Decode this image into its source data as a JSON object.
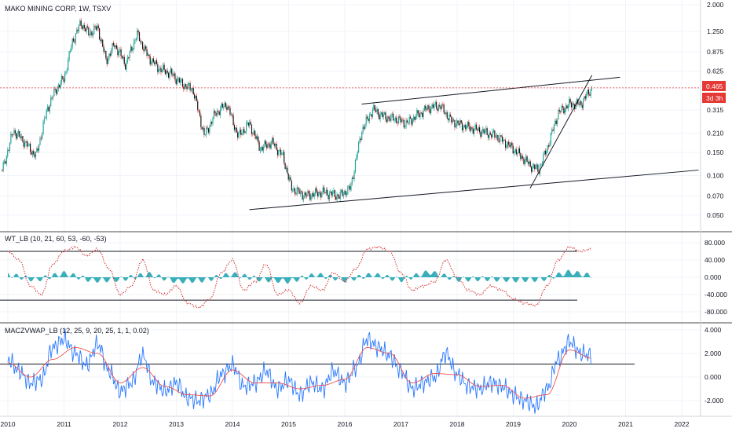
{
  "header": {
    "main_title": "MAKO MINING CORP, 1W, TSXV",
    "wt_title": "WT_LB (10, 21, 60, 53, -60, -53)",
    "macd_title": "MACZVWAP_LB (12, 25, 9, 20, 25, 1, 1, 0.02)"
  },
  "price_badge": {
    "value": "0.465",
    "countdown": "3d 3h"
  },
  "colors": {
    "up": "#26a69a",
    "down": "#ef5350",
    "candle_body": "#1a1a1a",
    "price_line": "#e53935",
    "wave": "#22a6b3",
    "wt_red": "#d32f2f",
    "macd_blue": "#2979ff",
    "macd_red": "#ef5350"
  },
  "chart_data": [
    {
      "type": "candlestick",
      "title": "MAKO MINING CORP, 1W, TSXV",
      "scale": "log",
      "x_ticks": [
        "2010",
        "2011",
        "2012",
        "2013",
        "2014",
        "2015",
        "2016",
        "2017",
        "2018",
        "2019",
        "2020",
        "2021",
        "2022"
      ],
      "y_ticks": [
        "2.000",
        "1.250",
        "0.875",
        "0.625",
        "0.465",
        "0.315",
        "0.210",
        "0.150",
        "0.100",
        "0.070",
        "0.050"
      ],
      "ylim": [
        0.04,
        2.0
      ],
      "last_price": 0.465,
      "series": [
        {
          "name": "close-approx",
          "x": [
            2009.9,
            2010.1,
            2010.3,
            2010.5,
            2010.7,
            2010.85,
            2011.0,
            2011.15,
            2011.3,
            2011.45,
            2011.6,
            2011.75,
            2011.9,
            2012.1,
            2012.3,
            2012.5,
            2012.7,
            2012.9,
            2013.1,
            2013.3,
            2013.5,
            2013.7,
            2013.9,
            2014.1,
            2014.3,
            2014.5,
            2014.7,
            2014.9,
            2015.05,
            2015.3,
            2015.6,
            2015.9,
            2016.1,
            2016.3,
            2016.5,
            2016.7,
            2016.9,
            2017.1,
            2017.3,
            2017.5,
            2017.7,
            2017.9,
            2018.1,
            2018.4,
            2018.7,
            2019.0,
            2019.3,
            2019.45,
            2019.6,
            2019.8,
            2020.0,
            2020.2,
            2020.4
          ],
          "values": [
            0.11,
            0.22,
            0.18,
            0.14,
            0.32,
            0.45,
            0.55,
            1.05,
            1.45,
            1.2,
            1.35,
            0.75,
            1.0,
            0.7,
            1.2,
            0.8,
            0.65,
            0.6,
            0.5,
            0.45,
            0.2,
            0.3,
            0.35,
            0.2,
            0.25,
            0.16,
            0.18,
            0.14,
            0.08,
            0.07,
            0.075,
            0.07,
            0.08,
            0.22,
            0.32,
            0.28,
            0.27,
            0.25,
            0.29,
            0.33,
            0.34,
            0.26,
            0.24,
            0.22,
            0.2,
            0.16,
            0.12,
            0.11,
            0.16,
            0.3,
            0.35,
            0.35,
            0.465
          ]
        }
      ],
      "trendlines": [
        {
          "name": "upper-channel",
          "points": [
            [
              2016.3,
              0.35
            ],
            [
              2020.9,
              0.56
            ]
          ]
        },
        {
          "name": "lower-channel",
          "points": [
            [
              2014.3,
              0.055
            ],
            [
              2022.3,
              0.11
            ]
          ]
        },
        {
          "name": "steep-support",
          "points": [
            [
              2019.3,
              0.08
            ],
            [
              2020.4,
              0.58
            ]
          ]
        }
      ]
    },
    {
      "type": "line",
      "title": "WT_LB (10, 21, 60, 53, -60, -53)",
      "y_ticks": [
        "80.000",
        "40.000",
        "0.000",
        "-40.000",
        "-80.000"
      ],
      "ylim": [
        -100,
        100
      ],
      "levels": [
        60,
        -53
      ],
      "series": [
        {
          "name": "wt1",
          "x": [
            2010.0,
            2010.2,
            2010.4,
            2010.6,
            2010.8,
            2011.0,
            2011.2,
            2011.4,
            2011.6,
            2011.8,
            2012.0,
            2012.2,
            2012.4,
            2012.6,
            2012.8,
            2013.0,
            2013.2,
            2013.4,
            2013.6,
            2013.8,
            2014.0,
            2014.2,
            2014.4,
            2014.6,
            2014.8,
            2015.0,
            2015.2,
            2015.4,
            2015.6,
            2015.8,
            2016.0,
            2016.2,
            2016.4,
            2016.6,
            2016.8,
            2017.0,
            2017.2,
            2017.4,
            2017.6,
            2017.8,
            2018.0,
            2018.2,
            2018.4,
            2018.6,
            2018.8,
            2019.0,
            2019.2,
            2019.4,
            2019.6,
            2019.8,
            2020.0,
            2020.2,
            2020.4
          ],
          "values": [
            60,
            40,
            -20,
            -40,
            30,
            60,
            70,
            50,
            65,
            20,
            -40,
            -20,
            40,
            -30,
            -40,
            -20,
            -60,
            -70,
            -50,
            10,
            40,
            -30,
            -10,
            30,
            -40,
            -30,
            -60,
            -20,
            -30,
            10,
            -10,
            20,
            65,
            70,
            60,
            10,
            -30,
            -20,
            -10,
            40,
            0,
            -30,
            -40,
            -20,
            -30,
            -50,
            -60,
            -65,
            -20,
            40,
            70,
            60,
            65
          ]
        },
        {
          "name": "histogram",
          "x": [
            2010.0,
            2010.5,
            2011.0,
            2011.5,
            2012.0,
            2012.5,
            2013.0,
            2013.5,
            2014.0,
            2014.5,
            2015.0,
            2015.5,
            2016.0,
            2016.5,
            2017.0,
            2017.5,
            2018.0,
            2018.5,
            2019.0,
            2019.5,
            2020.0,
            2020.4
          ],
          "values": [
            10,
            -10,
            15,
            -12,
            -8,
            12,
            -15,
            -10,
            12,
            -8,
            -15,
            10,
            -10,
            10,
            -10,
            20,
            -8,
            -5,
            -10,
            -8,
            20,
            5
          ]
        }
      ]
    },
    {
      "type": "line",
      "title": "MACZVWAP_LB (12, 25, 9, 20, 25, 1, 1, 0.02)",
      "y_ticks": [
        "4.000",
        "2.000",
        "0.000",
        "-2.000"
      ],
      "ylim": [
        -3.2,
        4.4
      ],
      "level": 1.1,
      "series": [
        {
          "name": "macd",
          "x": [
            2010.0,
            2010.2,
            2010.4,
            2010.6,
            2010.8,
            2011.0,
            2011.2,
            2011.4,
            2011.6,
            2011.8,
            2012.0,
            2012.2,
            2012.4,
            2012.6,
            2012.8,
            2013.0,
            2013.2,
            2013.4,
            2013.6,
            2013.8,
            2014.0,
            2014.2,
            2014.4,
            2014.6,
            2014.8,
            2015.0,
            2015.2,
            2015.4,
            2015.6,
            2015.8,
            2016.0,
            2016.2,
            2016.4,
            2016.6,
            2016.8,
            2017.0,
            2017.2,
            2017.4,
            2017.6,
            2017.8,
            2018.0,
            2018.2,
            2018.4,
            2018.6,
            2018.8,
            2019.0,
            2019.2,
            2019.4,
            2019.6,
            2019.8,
            2020.0,
            2020.2,
            2020.4
          ],
          "values": [
            1.5,
            0.5,
            -0.5,
            -0.2,
            2.5,
            3.2,
            2.0,
            1.0,
            2.8,
            0.5,
            -1.2,
            -0.5,
            1.8,
            -0.5,
            -1.2,
            -0.5,
            -1.8,
            -2.0,
            -1.5,
            0.2,
            1.0,
            -0.8,
            -0.5,
            0.5,
            -1.0,
            -0.3,
            -1.5,
            -0.5,
            -1.0,
            0.5,
            -0.5,
            0.8,
            3.2,
            2.5,
            1.8,
            0.5,
            -1.0,
            -0.5,
            0.0,
            2.0,
            0.2,
            -0.8,
            -1.0,
            -0.5,
            -0.8,
            -1.5,
            -2.0,
            -2.5,
            -1.0,
            1.5,
            3.0,
            2.0,
            1.8
          ]
        },
        {
          "name": "signal",
          "x": [
            2010.0,
            2010.4,
            2010.8,
            2011.2,
            2011.6,
            2012.0,
            2012.4,
            2012.8,
            2013.2,
            2013.6,
            2014.0,
            2014.4,
            2014.8,
            2015.2,
            2015.6,
            2016.0,
            2016.4,
            2016.8,
            2017.2,
            2017.6,
            2018.0,
            2018.4,
            2018.8,
            2019.2,
            2019.6,
            2020.0,
            2020.4
          ],
          "values": [
            1.2,
            0.0,
            1.5,
            2.5,
            2.0,
            -0.5,
            0.8,
            -0.8,
            -1.5,
            -1.6,
            0.6,
            -0.5,
            -0.5,
            -1.0,
            -0.7,
            -0.2,
            2.5,
            2.0,
            -0.5,
            0.3,
            0.2,
            -0.8,
            -0.7,
            -1.8,
            -1.5,
            2.3,
            1.6
          ]
        }
      ]
    }
  ]
}
